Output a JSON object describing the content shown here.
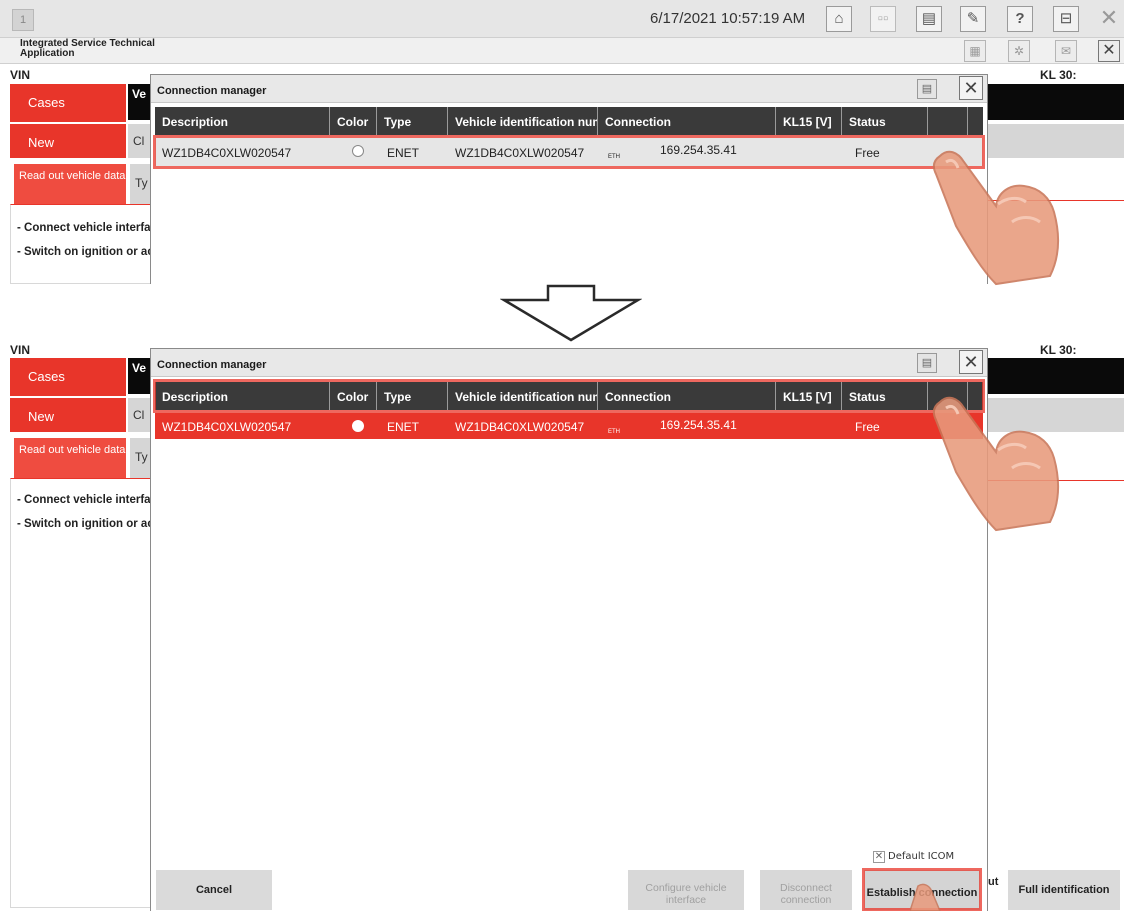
{
  "topbar": {
    "window_number": "1",
    "datetime": "6/17/2021 10:57:19 AM",
    "app_title": "Integrated Service Technical Application"
  },
  "background": {
    "vin_label": "VIN",
    "kl30_label": "KL 30:",
    "tabs": {
      "cases": "Cases",
      "new": "New"
    },
    "sub_tab": "Read out vehicle data",
    "black_strip": "Ve inf",
    "grey_strip_1": "Cl",
    "grey_strip_2": "Ty",
    "instructions": [
      "- Connect vehicle interfa",
      "- Switch on ignition or ac"
    ]
  },
  "dialog": {
    "title": "Connection manager",
    "columns": [
      "Description",
      "Color",
      "Type",
      "Vehicle identification num",
      "Connection",
      "KL15 [V]",
      "Status"
    ],
    "rows": [
      {
        "description": "WZ1DB4C0XLW020547",
        "type": "ENET",
        "vin": "WZ1DB4C0XLW020547",
        "connection_prefix": "ETH",
        "connection_ip": "169.254.35.41",
        "kl15": "",
        "status": "Free"
      }
    ],
    "default_icom_label": "Default ICOM",
    "default_icom_checked": false,
    "buttons": {
      "cancel": "Cancel",
      "configure": "Configure vehicle interface",
      "disconnect": "Disconnect connection",
      "establish": "Establish connection",
      "full_identification": "Full identification",
      "partial_right": "ut"
    }
  },
  "colors": {
    "accent_red": "#e8352a",
    "header_dark": "#3a3a3a",
    "row_grey": "#e6e6e6"
  },
  "icons": [
    "home-icon",
    "toggle-icon",
    "print-icon",
    "wrench-icon",
    "help-icon",
    "minimize-icon",
    "close-icon",
    "gear-icon",
    "mail-icon",
    "arrow-down-icon",
    "pointing-hand-icon"
  ]
}
